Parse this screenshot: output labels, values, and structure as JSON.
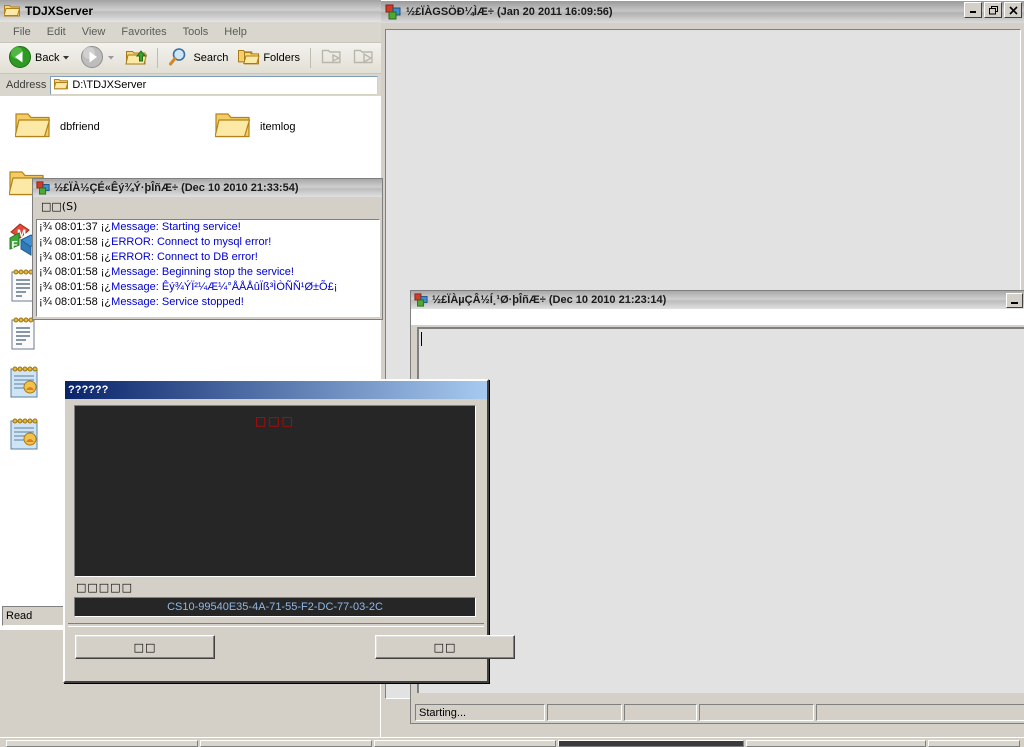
{
  "explorer": {
    "title": "TDJXServer",
    "menu": [
      "File",
      "Edit",
      "View",
      "Favorites",
      "Tools",
      "Help"
    ],
    "toolbar": {
      "back": "Back",
      "search": "Search",
      "folders": "Folders"
    },
    "address": {
      "label": "Address",
      "value": "D:\\TDJXServer"
    },
    "folders": [
      {
        "name": "dbfriend",
        "icon": "folder-icon"
      },
      {
        "name": "itemlog",
        "icon": "folder-icon"
      }
    ],
    "side_icons": [
      "folder-icon",
      "folder-icon",
      "office-suite-icon",
      "text-file-icon",
      "text-file-icon",
      "notepad-file-icon",
      "notepad-file-icon"
    ],
    "status": "Read"
  },
  "mdi": {
    "title": "½£ÏÀGSÖÐ¼ÌÆ÷ (Jan 20 2011 16:09:56)",
    "caption_buttons": [
      "minimize",
      "restore",
      "close"
    ]
  },
  "log_window": {
    "title": "½£ÏÀ½ÇÉ«Êý¾Ý·þÎñÆ÷ (Dec 10 2010 21:33:54)",
    "menu": "□□(S)",
    "lines": [
      {
        "prefix": "¡¾ 08:01:37 ¡¿",
        "message": "Message: Starting service!"
      },
      {
        "prefix": "¡¾ 08:01:58 ¡¿",
        "message": "ERROR: Connect to mysql error!"
      },
      {
        "prefix": "¡¾ 08:01:58 ¡¿",
        "message": "ERROR: Connect to DB error!"
      },
      {
        "prefix": "¡¾ 08:01:58 ¡¿",
        "message": "Message: Beginning stop the service!"
      },
      {
        "prefix": "¡¾ 08:01:58 ¡¿",
        "message": "Message: Êý¾ÝÏ²¼Æ¼°ÅÅÅûÏß³ÌÒÑÑ¹Ø±Õ£¡"
      },
      {
        "prefix": "¡¾ 08:01:58 ¡¿",
        "message": "Message: Service stopped!"
      }
    ]
  },
  "child_window": {
    "title": "½£ÏÀµÇÂ½Í¸¹Ø·þÎñÆ÷ (Dec 10 2010 21:23:14)",
    "status_panes": [
      "Starting...",
      "",
      "",
      "",
      ""
    ]
  },
  "dialog": {
    "title": "??????",
    "screen_text": "□□□",
    "field_label": "□□□□□",
    "serial": "CS10-99540E35-4A-71-55-F2-DC-77-03-2C",
    "ok_label": "□□",
    "cancel_label": "□□"
  },
  "colors": {
    "face": "#d4d0c8",
    "log_message": "#0000d0",
    "dialog_accent": "#0a246a",
    "serial_text": "#8fb8e8",
    "alert_red": "#e00000"
  }
}
